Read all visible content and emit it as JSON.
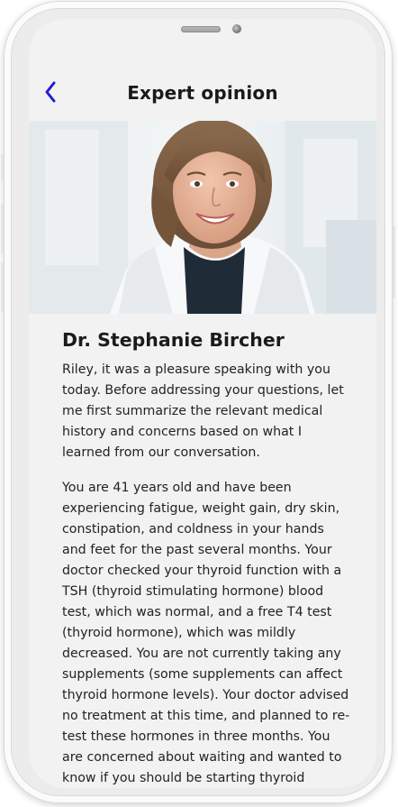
{
  "header": {
    "title": "Expert opinion",
    "back_icon": "chevron-left-icon",
    "back_color": "#1f1fd1"
  },
  "hero": {
    "description_icon": "doctor-photo"
  },
  "expert": {
    "name": "Dr. Stephanie Bircher"
  },
  "body": {
    "paragraphs": [
      "Riley, it was a pleasure speaking with you today. Before addressing your questions, let me first summarize the relevant medical history and concerns based on what I learned from our conversation.",
      "You are 41 years old and have been experiencing fatigue, weight gain, dry skin, constipation, and coldness in your hands and feet for the past several months. Your doctor checked your thyroid function with a TSH (thyroid stimulating hormone) blood test, which was normal, and a free T4 test (thyroid hormone), which was mildly decreased. You are not currently taking any supplements (some supplements can affect thyroid hormone levels). Your doctor advised no treatment at this time, and planned to re-test these hormones in three months. You are concerned about waiting and wanted to know if you should be starting thyroid"
    ]
  }
}
